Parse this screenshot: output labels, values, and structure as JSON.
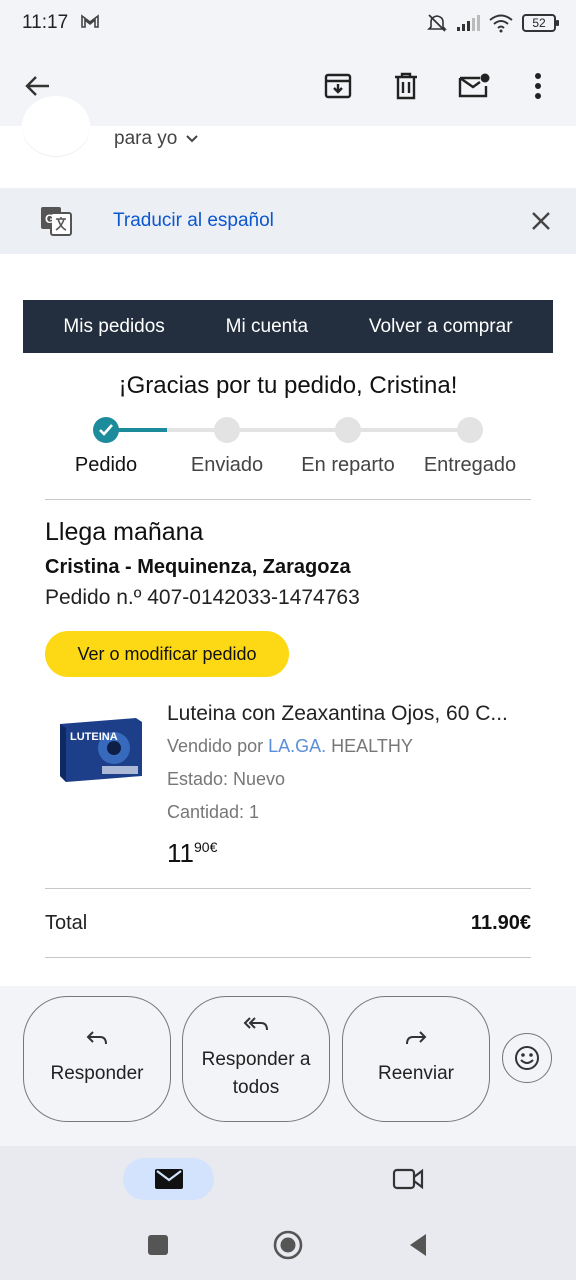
{
  "status_bar": {
    "time": "11:17",
    "battery": "52"
  },
  "toolbar": {
    "back_icon": "arrow-back-icon",
    "archive_icon": "archive-icon",
    "delete_icon": "trash-icon",
    "mark_unread_icon": "mark-unread-icon",
    "more_icon": "more-vert-icon"
  },
  "email": {
    "recipient_label": "para yo",
    "translate_label": "Traducir al español"
  },
  "order": {
    "nav": [
      "Mis pedidos",
      "Mi cuenta",
      "Volver a comprar"
    ],
    "thanks": "¡Gracias por tu pedido, Cristina!",
    "steps": [
      "Pedido",
      "Enviado",
      "En reparto",
      "Entregado"
    ],
    "arrival": "Llega mañana",
    "ship_to": "Cristina - Mequinenza, Zaragoza",
    "order_number": "Pedido n.º 407-0142033-1474763",
    "view_button": "Ver o modificar pedido",
    "product": {
      "title": "Luteina con Zeaxantina Ojos, 60 C...",
      "sold_by_prefix": "Vendido por",
      "seller_link": "LA.GA.",
      "seller_rest": "HEALTHY",
      "condition": "Estado: Nuevo",
      "quantity": "Cantidad: 1",
      "price_whole": "11",
      "price_fraction": "90€",
      "image_text": "LUTEINA"
    },
    "total_label": "Total",
    "total_value": "11.90€"
  },
  "actions": {
    "reply": "Responder",
    "reply_all": "Responder a todos",
    "forward": "Reenviar"
  },
  "colors": {
    "amazon_nav": "#232f3e",
    "tracker_active": "#1c8b9b",
    "button_yellow": "#fdd815",
    "link_blue": "#0b57d0"
  }
}
